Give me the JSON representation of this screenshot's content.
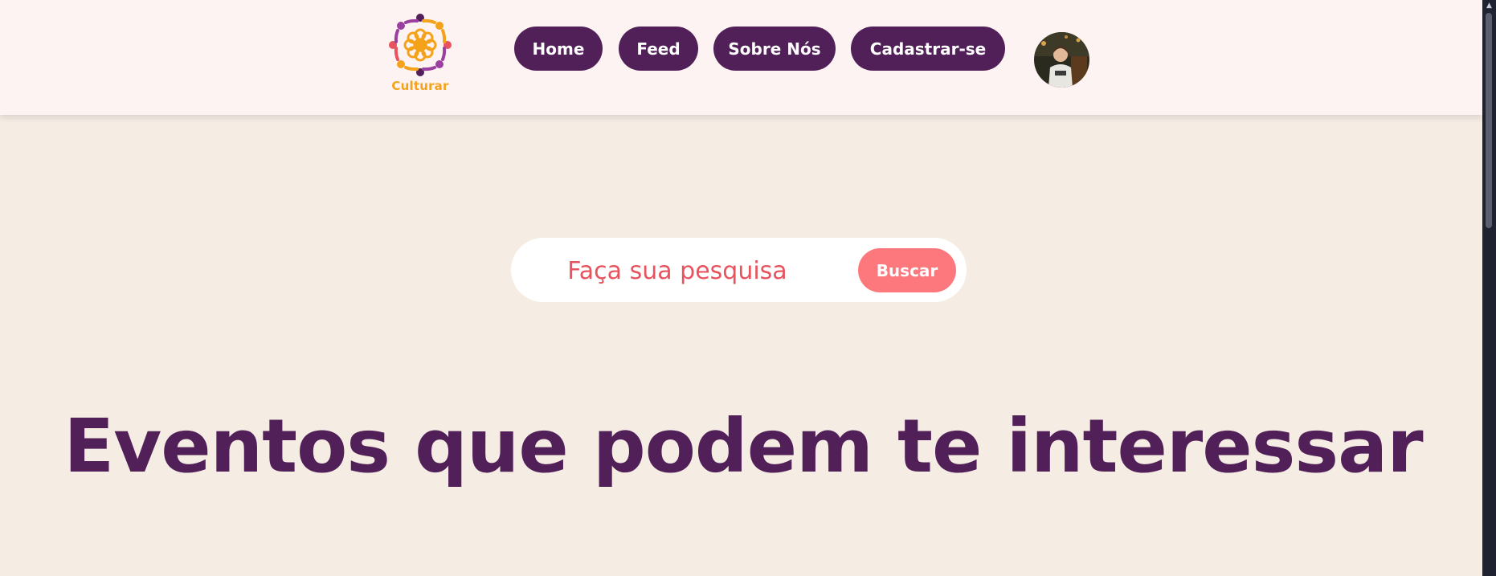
{
  "header": {
    "logo_text": "Culturar",
    "nav": [
      {
        "label": "Home"
      },
      {
        "label": "Feed"
      },
      {
        "label": "Sobre Nós"
      },
      {
        "label": "Cadastrar-se"
      }
    ]
  },
  "search": {
    "placeholder": "Faça sua pesquisa",
    "button_label": "Buscar"
  },
  "main": {
    "title": "Eventos que podem te interessar"
  },
  "colors": {
    "header_bg": "#fdf3f2",
    "page_bg": "#f5ede4",
    "brand_purple": "#522058",
    "search_button": "#fd787c",
    "search_text": "#e8535e",
    "logo_orange": "#f5a21b"
  },
  "icons": {
    "logo": "culturar-logo-icon",
    "avatar": "user-avatar",
    "scroll_up": "chevron-up-icon"
  }
}
